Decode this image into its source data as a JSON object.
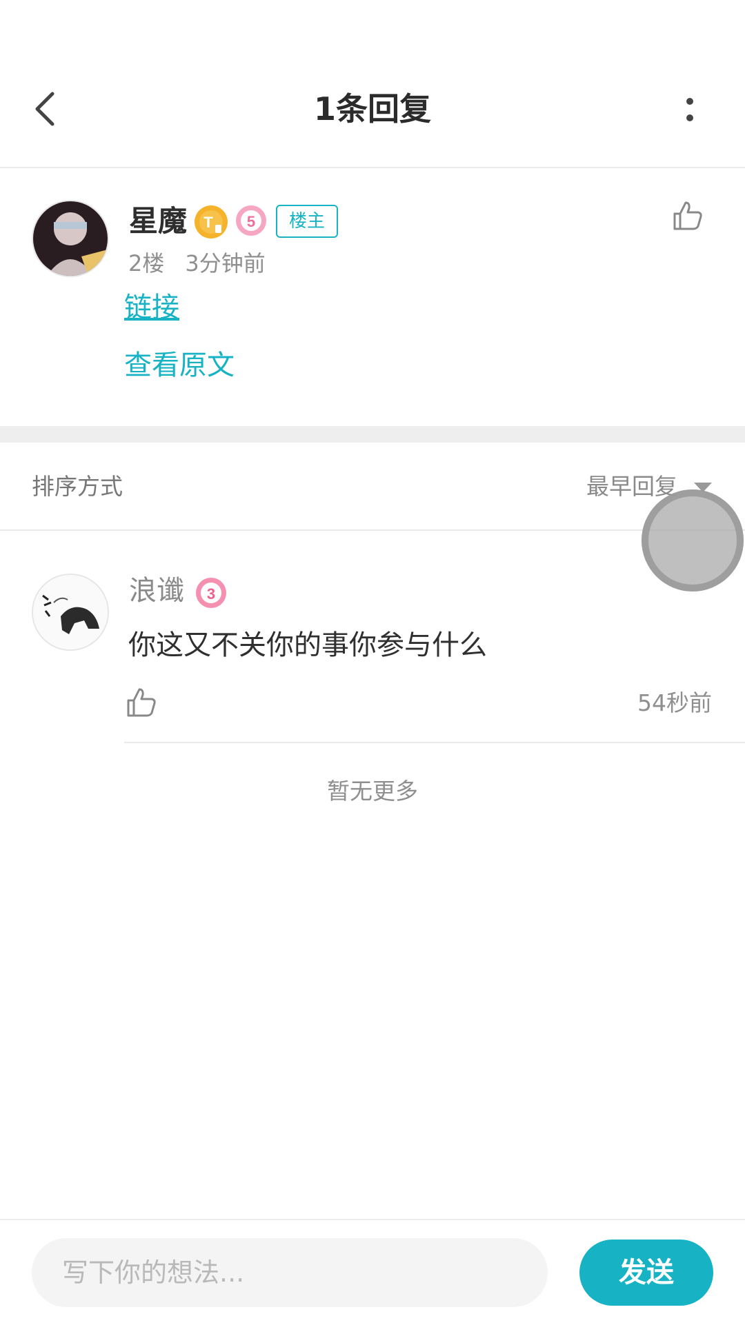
{
  "header": {
    "title": "1条回复"
  },
  "post": {
    "username": "星魔",
    "badge_t": "T",
    "badge_level": "5",
    "op_tag": "楼主",
    "floor": "2楼",
    "time": "3分钟前",
    "link_text": "链接",
    "view_original": "查看原文"
  },
  "sort": {
    "label": "排序方式",
    "value": "最早回复"
  },
  "reply": {
    "username": "浪谶",
    "badge_level": "3",
    "text": "你这又不关你的事你参与什么",
    "time": "54秒前"
  },
  "footer_note": "暂无更多",
  "input": {
    "placeholder": "写下你的想法...",
    "send_label": "发送"
  },
  "colors": {
    "accent": "#17b3c4",
    "gold_badge": "#f5b32b",
    "pink_badge": "#f6a6c0"
  },
  "icons": {
    "back": "chevron-left-icon",
    "more": "vertical-dots-icon",
    "like": "thumbs-up-icon",
    "sort_arrow": "triangle-down-icon"
  }
}
